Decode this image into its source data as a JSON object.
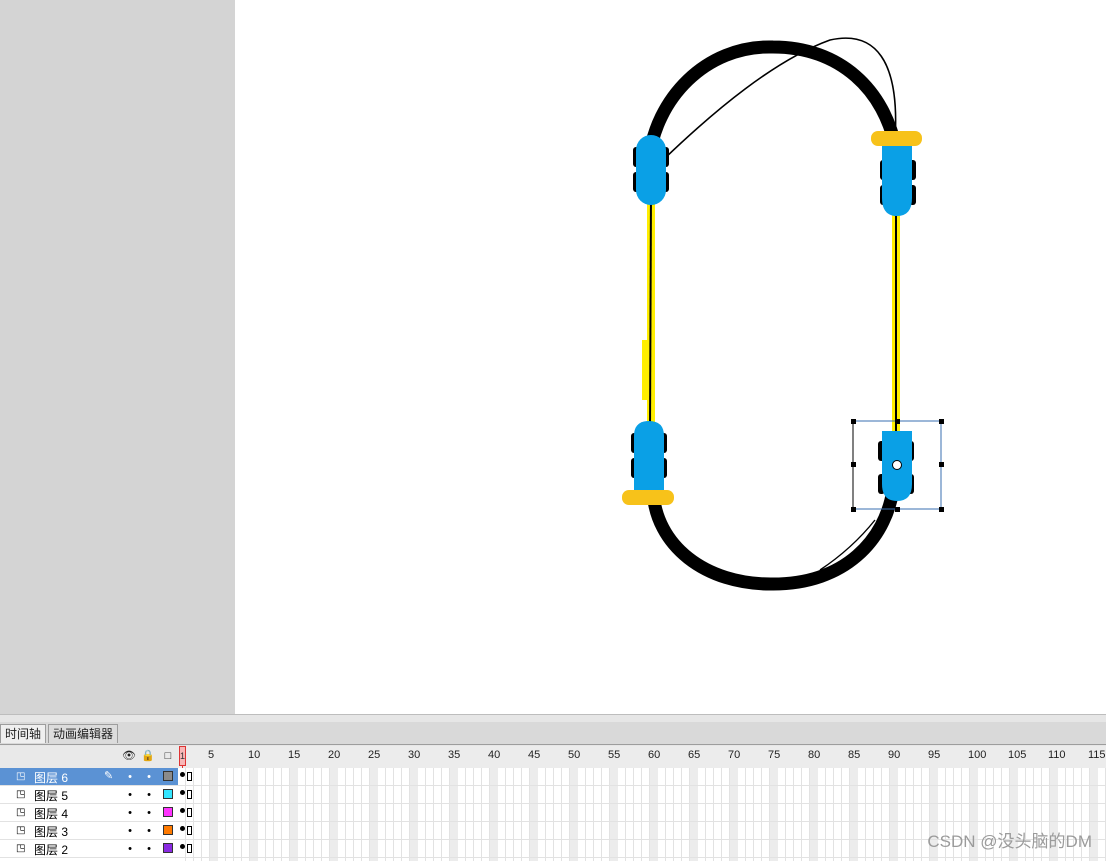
{
  "timeline_tabs": [
    {
      "label": "时间轴",
      "active": true
    },
    {
      "label": "动画编辑器",
      "active": false
    }
  ],
  "layer_header_icons": [
    "eye-icon",
    "lock-icon",
    "outline-icon"
  ],
  "ruler": {
    "current_frame": "1",
    "numbers": [
      "5",
      "10",
      "15",
      "20",
      "25",
      "30",
      "35",
      "40",
      "45",
      "50",
      "55",
      "60",
      "65",
      "70",
      "75",
      "80",
      "85",
      "90",
      "95",
      "100",
      "105",
      "110",
      "115"
    ]
  },
  "layers": [
    {
      "name": "图层 6",
      "color": "#8a8a8a",
      "selected": true
    },
    {
      "name": "图层 5",
      "color": "#33e5ff",
      "selected": false
    },
    {
      "name": "图层 4",
      "color": "#ff33ff",
      "selected": false
    },
    {
      "name": "图层 3",
      "color": "#ff7a00",
      "selected": false
    },
    {
      "name": "图层 2",
      "color": "#8a2be2",
      "selected": false
    }
  ],
  "stage_colors": {
    "track": "#000000",
    "train": "#0aa0e6",
    "rail": "#ffee00",
    "platform": "#f7c21a"
  },
  "watermark": "CSDN @没头脑的DM"
}
